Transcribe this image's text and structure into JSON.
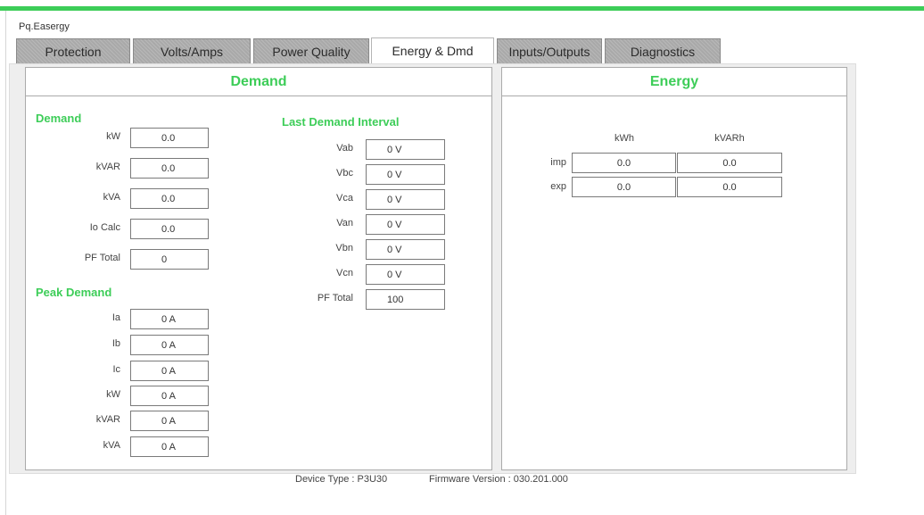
{
  "app": {
    "title": "Pq.Easergy",
    "accent_color": "#3dcd58"
  },
  "tabs": [
    {
      "label": "Protection",
      "active": false
    },
    {
      "label": "Volts/Amps",
      "active": false
    },
    {
      "label": "Power Quality",
      "active": false
    },
    {
      "label": "Energy & Dmd",
      "active": true
    },
    {
      "label": "Inputs/Outputs",
      "active": false
    },
    {
      "label": "Diagnostics",
      "active": false
    }
  ],
  "demand_panel": {
    "title": "Demand",
    "demand": {
      "heading": "Demand",
      "rows": [
        {
          "label": "kW",
          "value": "0.0"
        },
        {
          "label": "kVAR",
          "value": "0.0"
        },
        {
          "label": "kVA",
          "value": "0.0"
        },
        {
          "label": "Io Calc",
          "value": "0.0"
        },
        {
          "label": "PF Total",
          "value": "0"
        }
      ]
    },
    "peak_demand": {
      "heading": "Peak Demand",
      "rows": [
        {
          "label": "Ia",
          "value": "0 A"
        },
        {
          "label": "Ib",
          "value": "0 A"
        },
        {
          "label": "Ic",
          "value": "0 A"
        },
        {
          "label": "kW",
          "value": "0 A"
        },
        {
          "label": "kVAR",
          "value": "0 A"
        },
        {
          "label": "kVA",
          "value": "0 A"
        }
      ]
    },
    "last_interval": {
      "heading": "Last Demand Interval",
      "rows": [
        {
          "label": "Vab",
          "value": "0 V"
        },
        {
          "label": "Vbc",
          "value": "0 V"
        },
        {
          "label": "Vca",
          "value": "0 V"
        },
        {
          "label": "Van",
          "value": "0 V"
        },
        {
          "label": "Vbn",
          "value": "0 V"
        },
        {
          "label": "Vcn",
          "value": "0 V"
        },
        {
          "label": "PF Total",
          "value": "100"
        }
      ]
    }
  },
  "energy_panel": {
    "title": "Energy",
    "columns": [
      "kWh",
      "kVARh"
    ],
    "rows": [
      {
        "label": "imp",
        "kwh": "0.0",
        "kvarh": "0.0"
      },
      {
        "label": "exp",
        "kwh": "0.0",
        "kvarh": "0.0"
      }
    ]
  },
  "footer": {
    "device_type": "Device Type : P3U30",
    "firmware": "Firmware Version : 030.201.000"
  }
}
